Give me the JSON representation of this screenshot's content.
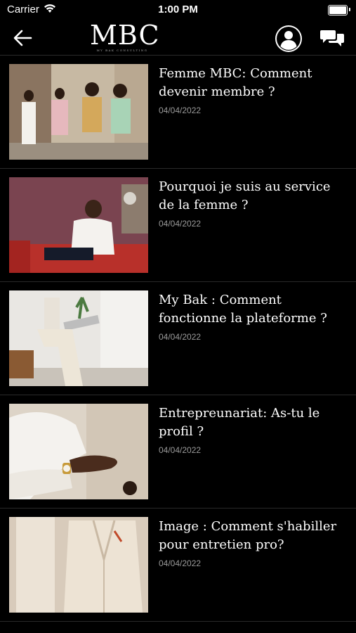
{
  "status_bar": {
    "carrier": "Carrier",
    "time": "1:00 PM"
  },
  "header": {
    "logo": "MBC",
    "logo_tagline": "MY BAK CONSULTING"
  },
  "articles": [
    {
      "title": "Femme MBC: Comment devenir membre ?",
      "date": "04/04/2022",
      "image": "women-in-suits-photo"
    },
    {
      "title": "Pourquoi je suis au service de la femme ?",
      "date": "04/04/2022",
      "image": "woman-on-red-sofa-photo"
    },
    {
      "title": "My Bak : Comment fonctionne la plateforme ?",
      "date": "04/04/2022",
      "image": "woman-with-laptop-photo"
    },
    {
      "title": "Entrepreunariat:  As-tu le profil ?",
      "date": "04/04/2022",
      "image": "hand-with-watch-photo"
    },
    {
      "title": "Image : Comment s'habiller pour entretien pro?",
      "date": "04/04/2022",
      "image": "beige-suit-photo"
    }
  ]
}
